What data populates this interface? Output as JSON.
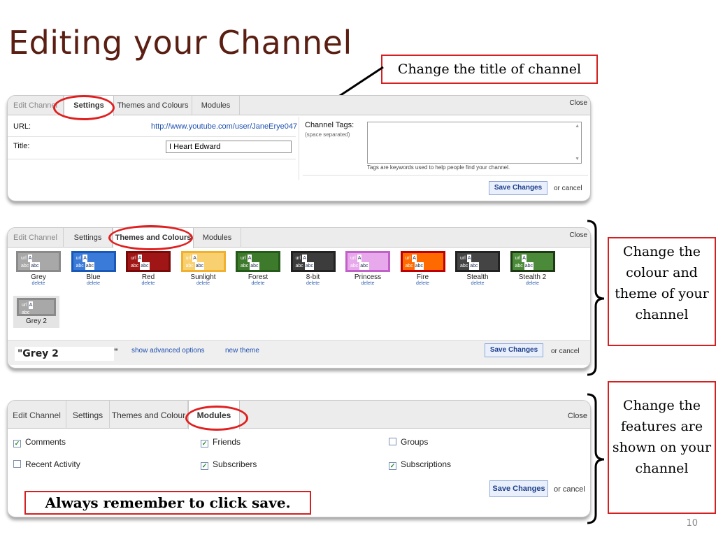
{
  "slide": {
    "title": "Editing your Channel",
    "page_number": "10"
  },
  "callouts": {
    "title_note": "Change the title of channel",
    "theme_note": "Change the colour and theme of your channel",
    "modules_note": "Change the features are shown on your channel",
    "save_note": "Always remember to click save."
  },
  "tabs": {
    "edit_channel": "Edit Channel",
    "settings": "Settings",
    "themes": "Themes and Colours",
    "themes_cut": "Themes and Colour",
    "modules": "Modules",
    "close": "Close"
  },
  "settings": {
    "url_label": "URL:",
    "url_value": "http://www.youtube.com/user/JaneErye047",
    "title_label": "Title:",
    "title_value": "I Heart Edward",
    "tags_label": "Channel Tags:",
    "tags_hint": "(space separated)",
    "tags_help": "Tags are keywords used to help people find your channel."
  },
  "buttons": {
    "save": "Save Changes",
    "or_cancel": "or cancel"
  },
  "themes": {
    "items": [
      {
        "name": "Grey",
        "delete": "delete",
        "frame": "#8a8a8a",
        "fill": "#a8a8a8"
      },
      {
        "name": "Blue",
        "delete": "delete",
        "frame": "#1a58b8",
        "fill": "#3a7ad8"
      },
      {
        "name": "Red",
        "delete": "delete",
        "frame": "#7a0a0a",
        "fill": "#a01515"
      },
      {
        "name": "Sunlight",
        "delete": "delete",
        "frame": "#f0b030",
        "fill": "#f8d070"
      },
      {
        "name": "Forest",
        "delete": "delete",
        "frame": "#245a1a",
        "fill": "#3e7a2c"
      },
      {
        "name": "8-bit",
        "delete": "delete",
        "frame": "#222222",
        "fill": "#3c3c3c"
      },
      {
        "name": "Princess",
        "delete": "delete",
        "frame": "#c060c8",
        "fill": "#e8a8ec"
      },
      {
        "name": "Fire",
        "delete": "delete",
        "frame": "#c00000",
        "fill": "#ff6a00"
      },
      {
        "name": "Stealth",
        "delete": "delete",
        "frame": "#222222",
        "fill": "#444444"
      },
      {
        "name": "Stealth 2",
        "delete": "delete",
        "frame": "#1e3a14",
        "fill": "#4a8a38"
      }
    ],
    "custom_theme": "Grey 2",
    "current_name": "\"Grey 2",
    "quote_close": "\"",
    "advanced": "show advanced options",
    "new_theme": "new theme"
  },
  "modules": {
    "items": [
      {
        "label": "Comments",
        "checked": true
      },
      {
        "label": "Friends",
        "checked": true
      },
      {
        "label": "Groups",
        "checked": false
      },
      {
        "label": "Recent Activity",
        "checked": false
      },
      {
        "label": "Subscribers",
        "checked": true
      },
      {
        "label": "Subscriptions",
        "checked": true
      }
    ]
  },
  "swatch_text": {
    "url": "url",
    "a": "A",
    "abc": "abc"
  },
  "colors": {
    "title": "#5a1e12",
    "annotation_red": "#e02020",
    "callout_border": "#d42020"
  }
}
